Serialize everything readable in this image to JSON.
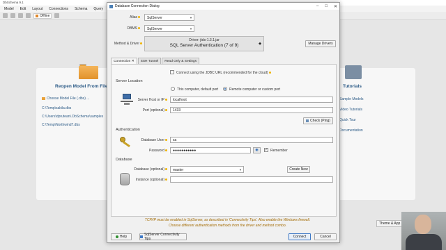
{
  "app": {
    "title": "DbSchema 9.1",
    "menu": [
      "Model",
      "Edit",
      "Layout",
      "Connections",
      "Schema",
      "Query"
    ],
    "toolbar": {
      "status": "Offline"
    }
  },
  "background": {
    "reopen_title": "Reopen Model From File",
    "choose_label": "Choose Model File (.dbs) ...",
    "recent_files": [
      "C:\\Temp\\sakila.dbs",
      "C:\\Users\\dprutean\\.DbSchema\\samples",
      "C:\\Temp\\Northwind7.dbs"
    ],
    "tutorials_title": "Tutorials",
    "tutorial_links": [
      "Sample Models",
      "Video Tutorials",
      "Quick Tour",
      "Documentation"
    ],
    "theme_button": "Theme & App"
  },
  "dialog": {
    "title": "Database Connection Dialog",
    "alias_label": "Alias",
    "alias_value": "SqlServer",
    "dbms_label": "DBMS",
    "dbms_value": "SqlServer",
    "method_label": "Method & Driver",
    "driver_line1": "Driver: jtds-1.3.1.jar",
    "driver_line2": "SQL Server Authentication (7 of 9)",
    "manage_drivers": "Manage Drivers",
    "tabs": [
      "Connection",
      "SSH Tunnel",
      "Read Only & Settings"
    ],
    "jdbc_url_label": "Connect using the JDBC URL (recommended for the cloud)",
    "server_location_section": "Server Location",
    "radio_local": "This computer, default port",
    "radio_remote": "Remote computer or custom port",
    "host_label": "Server Host or IP",
    "host_value": "localhost",
    "port_label": "Port (optional)",
    "port_value": "1433",
    "check_ping": "Check (Ping)",
    "authentication_section": "Authentication",
    "user_label": "Database User",
    "user_value": "sa",
    "password_label": "Password",
    "password_value": "●●●●●●●●●●●",
    "remember_label": "Remember",
    "database_section": "Database",
    "database_label": "Database (optional)",
    "database_value": "master",
    "create_new": "Create New",
    "instance_label": "Instance (optional)",
    "instance_value": "",
    "note_line1": "TCP/IP must be enabled in SqlServer, as described in 'Connectivity Tips'. Also enable the Windows firewall.",
    "note_line2": "Choose different authentication methods from the driver and method combo.",
    "help_button": "Help",
    "tips_button": "SqlServer Connectivity Tips",
    "connect_button": "Connect",
    "cancel_button": "Cancel"
  }
}
